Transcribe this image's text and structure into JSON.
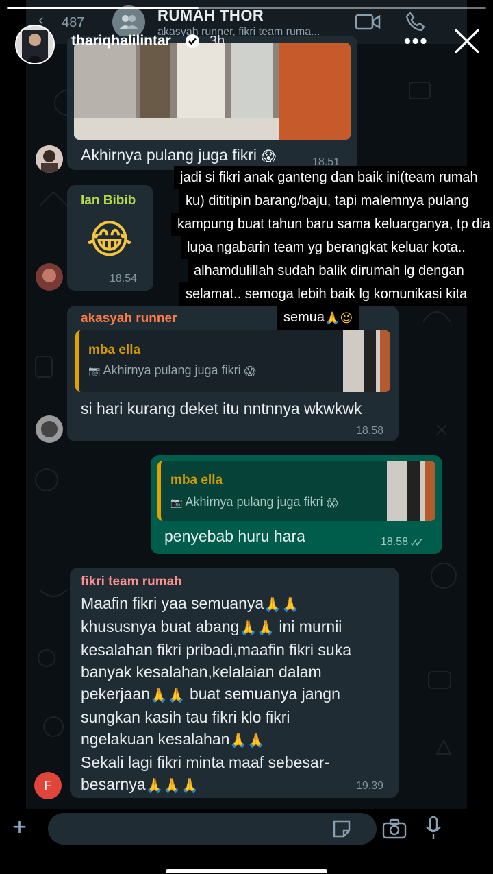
{
  "story": {
    "username": "thariqhalilintar",
    "time_ago": "3h",
    "more_label": "•••",
    "progress": 0.4,
    "caption_lines": [
      "jadi si fikri anak ganteng dan baik ini(team rumah",
      "ku) dititipin barang/baju, tapi malemnya pulang",
      "kampung buat tahun baru sama keluarganya, tp dia",
      "lupa ngabarin team yg berangkat keluar kota..",
      "alhamdulillah sudah balik dirumah lg dengan",
      "selamat.. semoga lebih baik lg komunikasi  kita",
      "semua"
    ],
    "caption_emoji": "🙏☺"
  },
  "chat": {
    "back_count": "487",
    "title": "RUMAH THOR",
    "members": "akasyah runner, fikri team ruma...",
    "messages": [
      {
        "text": "Akhirnya pulang juga fikri",
        "emoji": "😱",
        "time": "18.51"
      },
      {
        "sender": "Ian Bibib",
        "emoji": "😂",
        "time": "18.54"
      },
      {
        "sender": "akasyah runner",
        "quote_name": "mba ella",
        "quote_text": "Akhirnya pulang juga fikri",
        "quote_emoji": "😱",
        "text": "si hari kurang deket itu nntnnya wkwkwk",
        "time": "18.58"
      },
      {
        "quote_name": "mba ella",
        "quote_text": "Akhirnya pulang juga fikri",
        "quote_emoji": "😱",
        "text": "penyebab huru hara",
        "time": "18.58",
        "ticks": "✓✓"
      },
      {
        "sender": "fikri team rumah",
        "avatar_letter": "F",
        "lines": [
          {
            "text": "Maafin fikri yaa  semuanya",
            "emoji": "🙏🙏"
          },
          {
            "text": "khususnya buat abang",
            "emoji": "🙏🙏",
            "tail": " ini murnii"
          },
          {
            "text": "kesalahan fikri pribadi,maafin fikri suka",
            "emoji": ""
          },
          {
            "text": "banyak kesalahan,kelalaian dalam",
            "emoji": ""
          },
          {
            "text": "pekerjaan",
            "emoji": "🙏🙏",
            "tail": " buat semuanya jangn"
          },
          {
            "text": "sungkan kasih tau fikri klo fikri",
            "emoji": ""
          },
          {
            "text": "ngelakuan kesalahan",
            "emoji": "🙏🙏"
          },
          {
            "text": "Sekali lagi fikri minta maaf sebesar-",
            "emoji": ""
          },
          {
            "text": "besarnya",
            "emoji": "🙏🙏🙏"
          }
        ],
        "time": "19.39"
      }
    ]
  },
  "colors": {
    "chat_bg": "#0b1014",
    "bubble_in": "#1f2c34",
    "bubble_out": "#005c4b",
    "ian_name": "#b7d94a",
    "akasyah_name": "#ff7a45",
    "fikri_name": "#ff8f8f",
    "quote_name": "#d59c00"
  }
}
